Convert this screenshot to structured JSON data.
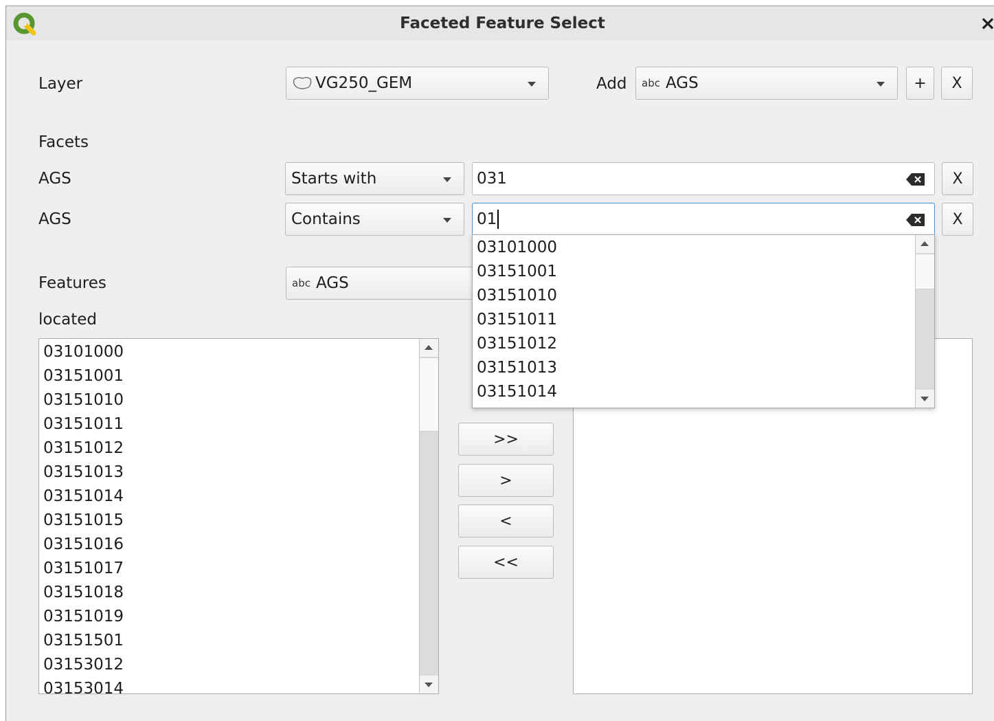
{
  "window": {
    "title": "Faceted Feature Select",
    "close_glyph": "×",
    "app_icon": "qgis-logo-icon"
  },
  "layer": {
    "label": "Layer",
    "selected": "VG250_GEM",
    "icon": "polygon-layer-icon"
  },
  "add": {
    "label": "Add",
    "field_prefix": "abc",
    "field_selected": "AGS",
    "plus_label": "+",
    "remove_label": "X"
  },
  "facets": {
    "heading": "Facets",
    "rows": [
      {
        "field": "AGS",
        "operator": "Starts with",
        "value": "031",
        "remove_label": "X"
      },
      {
        "field": "AGS",
        "operator": "Contains",
        "value": "01",
        "remove_label": "X"
      }
    ]
  },
  "autocomplete": {
    "items": [
      "03101000",
      "03151001",
      "03151010",
      "03151011",
      "03151012",
      "03151013",
      "03151014"
    ]
  },
  "features": {
    "label": "Features",
    "field_prefix": "abc",
    "field_selected": "AGS",
    "located_label": "located",
    "located_items": [
      "03101000",
      "03151001",
      "03151010",
      "03151011",
      "03151012",
      "03151013",
      "03151014",
      "03151015",
      "03151016",
      "03151017",
      "03151018",
      "03151019",
      "03151501",
      "03153012",
      "03153014"
    ]
  },
  "transfer": {
    "add_all": ">>",
    "add_one": ">",
    "remove_one": "<",
    "remove_all": "<<"
  },
  "colors": {
    "focus_border": "#3d8ee0",
    "qgis_green": "#589632",
    "qgis_yellow": "#ee7913"
  }
}
